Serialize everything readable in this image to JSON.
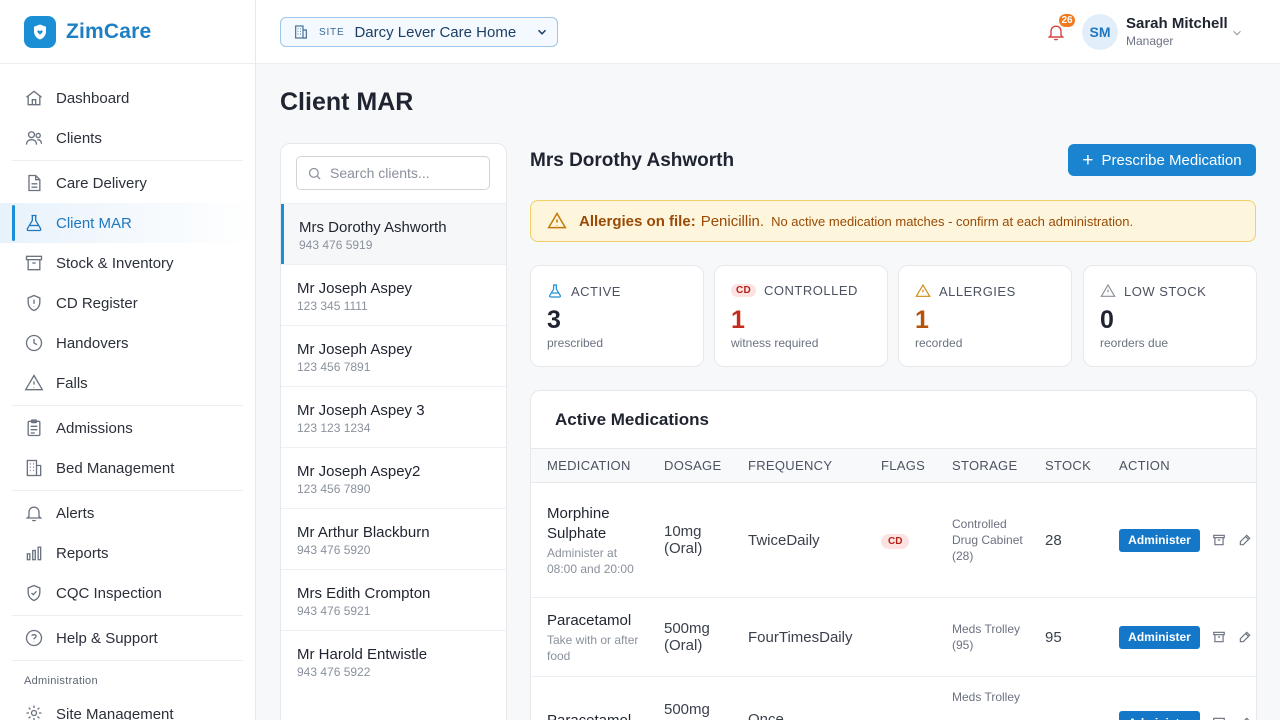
{
  "brand": {
    "name": "ZimCare",
    "color": "#1a8fd6"
  },
  "nav": {
    "items": [
      {
        "label": "Dashboard",
        "icon": "home-icon"
      },
      {
        "label": "Clients",
        "icon": "users-icon"
      },
      {
        "label": "Care Delivery",
        "icon": "document-icon"
      },
      {
        "label": "Client MAR",
        "icon": "flask-icon",
        "active": true
      },
      {
        "label": "Stock & Inventory",
        "icon": "archive-icon"
      },
      {
        "label": "CD Register",
        "icon": "shield-icon"
      },
      {
        "label": "Handovers",
        "icon": "clock-icon"
      },
      {
        "label": "Falls",
        "icon": "warning-icon"
      },
      {
        "label": "Admissions",
        "icon": "clipboard-icon"
      },
      {
        "label": "Bed Management",
        "icon": "building-icon"
      },
      {
        "label": "Alerts",
        "icon": "bell-icon"
      },
      {
        "label": "Reports",
        "icon": "bar-chart-icon"
      },
      {
        "label": "CQC Inspection",
        "icon": "shield-check-icon"
      },
      {
        "label": "Help & Support",
        "icon": "help-circle-icon"
      }
    ],
    "section_admin": "Administration",
    "site_management": "Site Management"
  },
  "topbar": {
    "site_tag": "SITE",
    "site_name": "Darcy Lever Care Home",
    "notifications": "26",
    "user_initials": "SM",
    "user_name": "Sarah Mitchell",
    "user_role": "Manager"
  },
  "page": {
    "title": "Client MAR"
  },
  "search": {
    "placeholder": "Search clients..."
  },
  "clients": [
    {
      "name": "Mrs Dorothy Ashworth",
      "id": "943 476 5919",
      "selected": true
    },
    {
      "name": "Mr Joseph Aspey",
      "id": "123 345 1111"
    },
    {
      "name": "Mr Joseph Aspey",
      "id": "123 456 7891"
    },
    {
      "name": "Mr Joseph Aspey 3",
      "id": "123 123 1234"
    },
    {
      "name": "Mr Joseph Aspey2",
      "id": "123 456 7890"
    },
    {
      "name": "Mr Arthur Blackburn",
      "id": "943 476 5920"
    },
    {
      "name": "Mrs Edith Crompton",
      "id": "943 476 5921"
    },
    {
      "name": "Mr Harold Entwistle",
      "id": "943 476 5922"
    }
  ],
  "detail": {
    "client_name": "Mrs Dorothy Ashworth",
    "prescribe_label": "Prescribe Medication",
    "allergy": {
      "title": "Allergies on file:",
      "value": "Penicillin.",
      "note": "No active medication matches - confirm at each administration."
    },
    "stats": [
      {
        "label": "ACTIVE",
        "value": "3",
        "sub": "prescribed",
        "color": "#1f2430"
      },
      {
        "label": "CONTROLLED",
        "value": "1",
        "sub": "witness required",
        "badge": "CD",
        "color": "#c42b1c"
      },
      {
        "label": "ALLERGIES",
        "value": "1",
        "sub": "recorded",
        "color": "#b45309"
      },
      {
        "label": "LOW STOCK",
        "value": "0",
        "sub": "reorders due",
        "color": "#1f2430"
      }
    ]
  },
  "meds": {
    "title": "Active Medications",
    "columns": [
      "MEDICATION",
      "DOSAGE",
      "FREQUENCY",
      "FLAGS",
      "STORAGE",
      "STOCK",
      "ACTION"
    ],
    "administer_label": "Administer",
    "rows": [
      {
        "name": "Morphine Sulphate",
        "note": "Administer at 08:00 and 20:00",
        "dosage": "10mg (Oral)",
        "frequency": "TwiceDaily",
        "flag": "CD",
        "storage": "Controlled Drug Cabinet (28)",
        "stock": "28"
      },
      {
        "name": "Paracetamol",
        "note": "Take with or after food",
        "dosage": "500mg (Oral)",
        "frequency": "FourTimesDaily",
        "flag": "",
        "storage": "Meds Trolley (95)",
        "stock": "95"
      },
      {
        "name": "Paracetamol",
        "note": "",
        "dosage": "500mg",
        "frequency": "Once",
        "flag": "",
        "storage": "Meds Trolley",
        "stock": ""
      }
    ]
  }
}
